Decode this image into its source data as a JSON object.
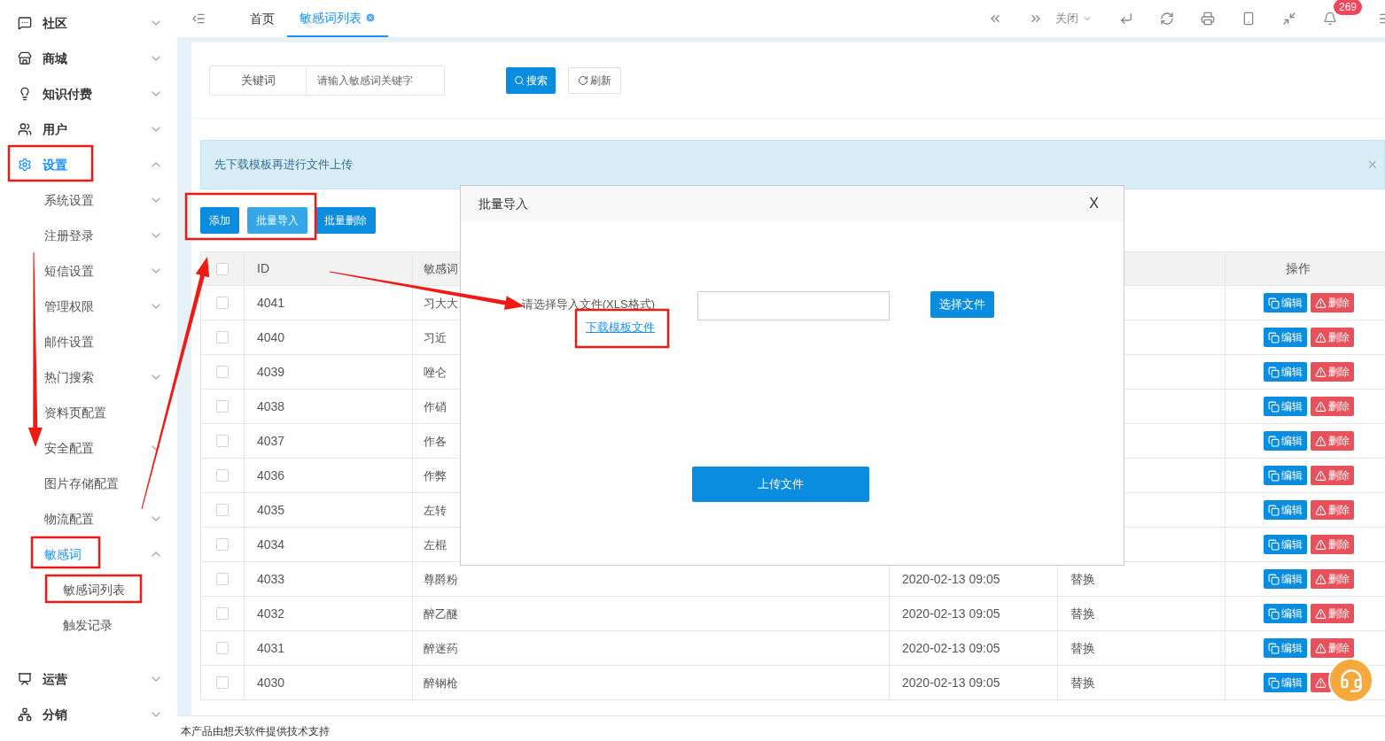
{
  "sidebar": {
    "items": [
      {
        "label": "社区",
        "selected": false,
        "expanded": false
      },
      {
        "label": "商城",
        "selected": false,
        "expanded": false
      },
      {
        "label": "知识付费",
        "selected": false,
        "expanded": false
      },
      {
        "label": "用户",
        "selected": false,
        "expanded": false
      },
      {
        "label": "设置",
        "selected": true,
        "expanded": true,
        "children": [
          {
            "label": "系统设置",
            "selected": false,
            "expanded": false
          },
          {
            "label": "注册登录",
            "selected": false,
            "expanded": false
          },
          {
            "label": "短信设置",
            "selected": false,
            "expanded": false
          },
          {
            "label": "管理权限",
            "selected": false,
            "expanded": false
          },
          {
            "label": "邮件设置",
            "selected": false
          },
          {
            "label": "热门搜索",
            "selected": false,
            "expanded": false
          },
          {
            "label": "资料页配置",
            "selected": false
          },
          {
            "label": "安全配置",
            "selected": false,
            "expanded": false
          },
          {
            "label": "图片存储配置",
            "selected": false
          },
          {
            "label": "物流配置",
            "selected": false,
            "expanded": false
          },
          {
            "label": "敏感词",
            "selected": true,
            "expanded": true,
            "children": [
              {
                "label": "敏感词列表",
                "selected": false
              },
              {
                "label": "触发记录",
                "selected": false
              }
            ]
          }
        ]
      },
      {
        "label": "运营",
        "selected": false,
        "expanded": false
      },
      {
        "label": "分销",
        "selected": false,
        "expanded": false
      }
    ]
  },
  "topbar": {
    "tabs": [
      {
        "label": "首页",
        "selected": false
      },
      {
        "label": "敏感词列表",
        "selected": true
      }
    ],
    "close_menu": "关闭",
    "notification_count": "269"
  },
  "search": {
    "label": "关键词",
    "placeholder": "请输入敏感词关键字",
    "search_button": "搜索",
    "refresh_button": "刷新"
  },
  "alert": {
    "text": "先下载模板再进行文件上传",
    "close": "×"
  },
  "actions": [
    {
      "label": "添加",
      "active": false
    },
    {
      "label": "批量导入",
      "active": true
    },
    {
      "label": "批量删除",
      "active": false
    }
  ],
  "table": {
    "all_checked": false,
    "headers": [
      "ID",
      "敏感词",
      "操作"
    ],
    "rows": [
      {
        "checked": false,
        "id": "4041",
        "word": "习大大",
        "edit": "编辑",
        "delete": "删除"
      },
      {
        "checked": false,
        "id": "4040",
        "word": "习近",
        "edit": "编辑",
        "delete": "删除"
      },
      {
        "checked": false,
        "id": "4039",
        "word": "唑仑",
        "edit": "编辑",
        "delete": "删除"
      },
      {
        "checked": false,
        "id": "4038",
        "word": "作硝",
        "edit": "编辑",
        "delete": "删除"
      },
      {
        "checked": false,
        "id": "4037",
        "word": "作各",
        "edit": "编辑",
        "delete": "删除"
      },
      {
        "checked": false,
        "id": "4036",
        "word": "作弊",
        "edit": "编辑",
        "delete": "删除"
      },
      {
        "checked": false,
        "id": "4035",
        "word": "左转",
        "edit": "编辑",
        "delete": "删除"
      },
      {
        "checked": false,
        "id": "4034",
        "word": "左棍",
        "edit": "编辑",
        "delete": "删除"
      },
      {
        "checked": false,
        "id": "4033",
        "word": "尊爵粉",
        "time": "2020-02-13 09:05",
        "type": "替换",
        "edit": "编辑",
        "delete": "删除"
      },
      {
        "checked": false,
        "id": "4032",
        "word": "醉乙醚",
        "time": "2020-02-13 09:05",
        "type": "替换",
        "edit": "编辑",
        "delete": "删除"
      },
      {
        "checked": false,
        "id": "4031",
        "word": "醉迷药",
        "time": "2020-02-13 09:05",
        "type": "替换",
        "edit": "编辑",
        "delete": "删除"
      },
      {
        "checked": false,
        "id": "4030",
        "word": "醉钢枪",
        "time": "2020-02-13 09:05",
        "type": "替换",
        "edit": "编辑"
      }
    ]
  },
  "dialog": {
    "title": "批量导入",
    "close": "X",
    "file_label": "请选择导入文件(XLS格式)",
    "template_link": "下载模板文件",
    "choose_button": "选择文件",
    "upload_button": "上传文件"
  },
  "footer": "本产品由想天软件提供技术支持"
}
